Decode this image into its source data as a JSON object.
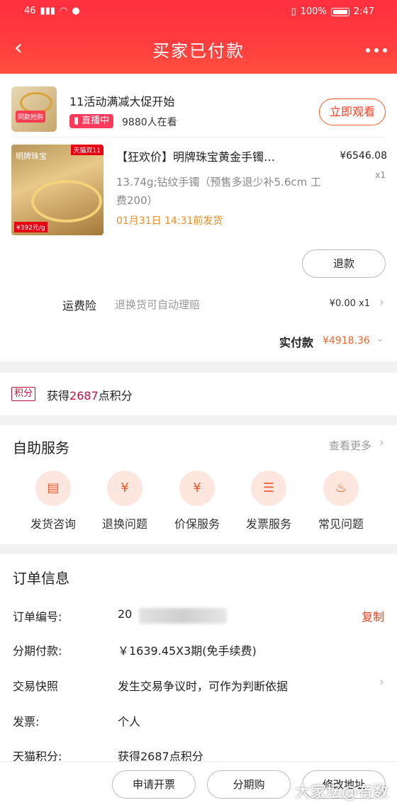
{
  "status_bar": {
    "signal": "46",
    "battery_pct": "100%",
    "time": "2:47"
  },
  "nav": {
    "title": "买家已付款"
  },
  "live": {
    "thumb_tag": "同款抢购",
    "title": "11活动满减大促开始",
    "badge": "直播中",
    "viewers": "9880人在看",
    "watch_button": "立即观看"
  },
  "product": {
    "img_brand": "明牌珠宝",
    "img_tmall": "天猫双11",
    "img_price": "¥392元/g",
    "title": "【狂欢价】明牌珠宝黄金手镯…",
    "price": "¥6546.08",
    "qty": "x1",
    "spec": "13.74g;钻纹手镯（预售多退少补5.6cm 工费200）",
    "ship_time": "01月31日 14:31前发货",
    "refund_button": "退款"
  },
  "insurance": {
    "label": "运费险",
    "desc": "退换货可自动理赔",
    "price": "¥0.00 x1"
  },
  "paid": {
    "label": "实付款",
    "value": "¥4918.36"
  },
  "points": {
    "tag": "积分",
    "prefix": "获得",
    "amount": "2687",
    "suffix": "点积分"
  },
  "services": {
    "title": "自助服务",
    "more": "查看更多",
    "items": [
      {
        "label": "发货咨询",
        "icon": "truck-icon"
      },
      {
        "label": "退换问题",
        "icon": "refund-icon"
      },
      {
        "label": "价保服务",
        "icon": "price-protect-icon"
      },
      {
        "label": "发票服务",
        "icon": "invoice-icon"
      },
      {
        "label": "常见问题",
        "icon": "fire-icon"
      }
    ]
  },
  "order_info": {
    "title": "订单信息",
    "order_no_label": "订单编号:",
    "order_no_partial": "20",
    "copy": "复制",
    "installment_label": "分期付款:",
    "installment_value": "￥1639.45X3期(免手续费)",
    "snapshot_label": "交易快照",
    "snapshot_value": "发生交易争议时，可作为判断依据",
    "invoice_label": "发票:",
    "invoice_value": "个人",
    "tmall_points_label": "天猫积分:",
    "tmall_points_value": "获得2687点积分"
  },
  "bottom_bar": {
    "invoice_btn": "申请开票",
    "installment_btn": "分期购",
    "address_btn": "修改地址"
  },
  "watermark": "大家坛@有数",
  "colors": {
    "header_red": "#ff3b3b",
    "accent_orange": "#f0642a",
    "points_red": "#c0123c"
  }
}
